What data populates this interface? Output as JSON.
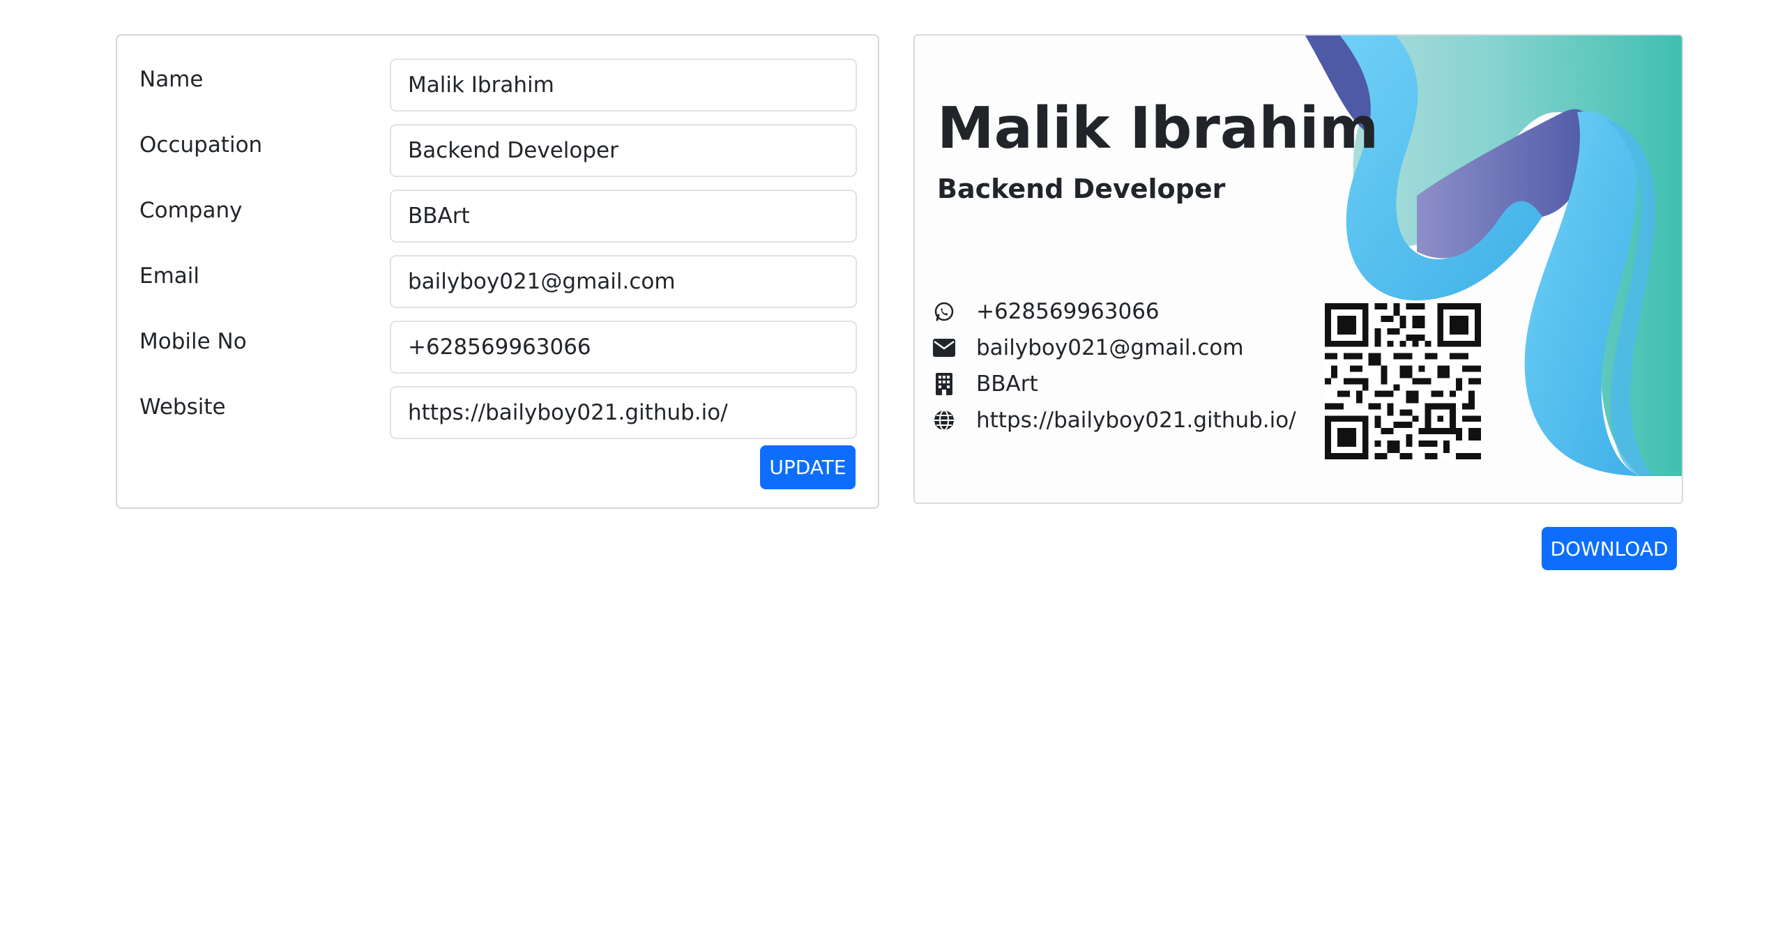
{
  "form": {
    "fields": [
      {
        "label": "Name",
        "value": "Malik Ibrahim"
      },
      {
        "label": "Occupation",
        "value": "Backend Developer"
      },
      {
        "label": "Company",
        "value": "BBArt"
      },
      {
        "label": "Email",
        "value": "bailyboy021@gmail.com"
      },
      {
        "label": "Mobile No",
        "value": "+628569963066"
      },
      {
        "label": "Website",
        "value": "https://bailyboy021.github.io/"
      }
    ],
    "update_label": "UPDATE"
  },
  "card": {
    "name": "Malik Ibrahim",
    "occupation": "Backend Developer",
    "contacts": [
      {
        "icon": "whatsapp-icon",
        "text": "+628569963066"
      },
      {
        "icon": "envelope-icon",
        "text": "bailyboy021@gmail.com"
      },
      {
        "icon": "building-icon",
        "text": "BBArt"
      },
      {
        "icon": "globe-icon",
        "text": "https://bailyboy021.github.io/"
      }
    ],
    "accent_colors": [
      "#5b67b3",
      "#5bc4ef",
      "#45c1b4"
    ]
  },
  "download_label": "DOWNLOAD"
}
